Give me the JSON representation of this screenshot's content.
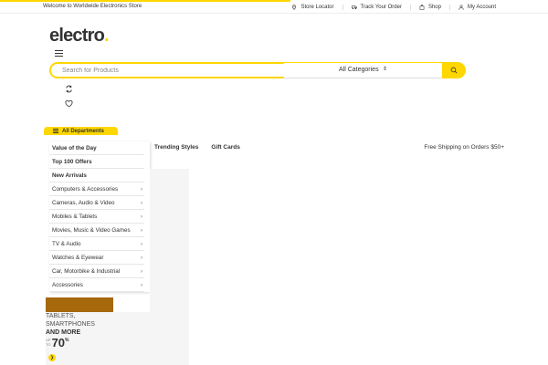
{
  "topbar": {
    "welcome": "Welcome to Worldwide Electronics Store",
    "links": [
      {
        "label": "Store Locator",
        "icon": "map-pin-icon"
      },
      {
        "label": "Track Your Order",
        "icon": "truck-icon"
      },
      {
        "label": "Shop",
        "icon": "bag-icon"
      },
      {
        "label": "My Account",
        "icon": "user-icon"
      }
    ]
  },
  "brand": {
    "name": "electro",
    "dot": ".",
    "accent_color": "#fed700"
  },
  "search": {
    "placeholder": "Search for Products",
    "category_selected": "All Categories"
  },
  "departments": {
    "label": "All Departments",
    "items": [
      {
        "label": "Value of the Day",
        "bold": true
      },
      {
        "label": "Top 100 Offers",
        "bold": true
      },
      {
        "label": "New Arrivals",
        "bold": true
      },
      {
        "label": "Computers & Accessories",
        "bold": false
      },
      {
        "label": "Cameras, Audio & Video",
        "bold": false
      },
      {
        "label": "Mobiles & Tablets",
        "bold": false
      },
      {
        "label": "Movies, Music & Video Games",
        "bold": false
      },
      {
        "label": "TV & Audio",
        "bold": false
      },
      {
        "label": "Watches & Eyewear",
        "bold": false
      },
      {
        "label": "Car, Motorbike & Industrial",
        "bold": false
      },
      {
        "label": "Accessories",
        "bold": false
      }
    ]
  },
  "secondary_nav": {
    "links": [
      "Trending Styles",
      "Gift Cards"
    ],
    "shipping": "Free Shipping on Orders $50+"
  },
  "promo": {
    "line1": "TABLETS,",
    "line2": "SMARTPHONES",
    "line3": "AND MORE",
    "upto_1": "UP",
    "upto_2": "TO",
    "value": "70",
    "unit": "%",
    "bar_color": "#a5680b"
  }
}
